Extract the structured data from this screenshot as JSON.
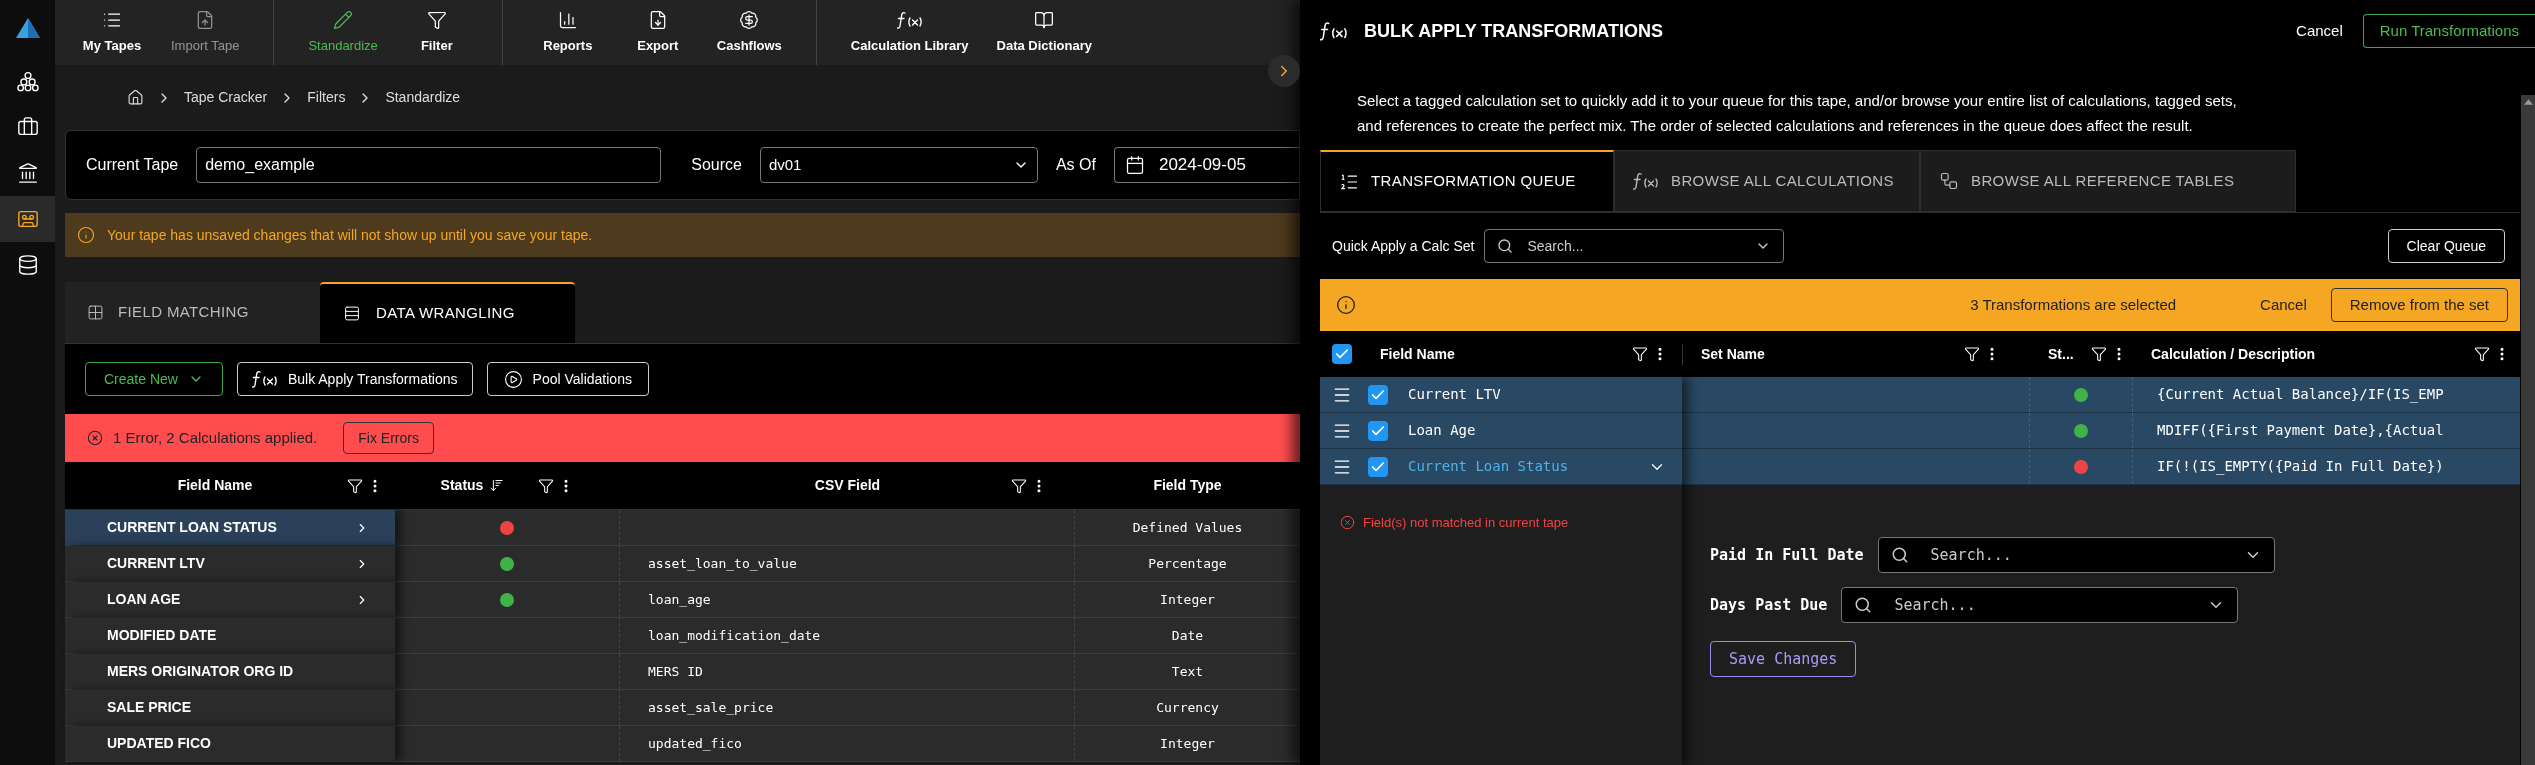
{
  "rail": {
    "items": [
      {
        "kind": "network",
        "selected": false
      },
      {
        "kind": "briefcase",
        "selected": false
      },
      {
        "kind": "bank",
        "selected": false
      },
      {
        "kind": "tape",
        "selected": true
      },
      {
        "kind": "database",
        "selected": false
      }
    ]
  },
  "toolbar": {
    "groups": [
      {
        "items": [
          {
            "kind": "list",
            "label": "My Tapes",
            "selected": false,
            "disabled": false
          },
          {
            "kind": "import",
            "label": "Import Tape",
            "selected": false,
            "disabled": true
          }
        ]
      },
      {
        "items": [
          {
            "kind": "pencil",
            "label": "Standardize",
            "selected": true,
            "disabled": false
          },
          {
            "kind": "filter",
            "label": "Filter",
            "selected": false,
            "disabled": false
          }
        ]
      },
      {
        "items": [
          {
            "kind": "chart",
            "label": "Reports",
            "selected": false,
            "disabled": false
          },
          {
            "kind": "export",
            "label": "Export",
            "selected": false,
            "disabled": false
          },
          {
            "kind": "dollar",
            "label": "Cashflows",
            "selected": false,
            "disabled": false
          }
        ]
      },
      {
        "items": [
          {
            "kind": "function",
            "label": "Calculation Library",
            "selected": false,
            "disabled": false
          },
          {
            "kind": "book",
            "label": "Data Dictionary",
            "selected": false,
            "disabled": false
          }
        ]
      }
    ]
  },
  "breadcrumb": [
    "Tape Cracker",
    "Filters",
    "Standardize"
  ],
  "tape_form": {
    "current_tape_label": "Current Tape",
    "current_tape": "demo_example",
    "source_label": "Source",
    "source": "dv01",
    "as_of_label": "As Of",
    "as_of": "2024-09-05"
  },
  "warning": "Your tape has unsaved changes that will not show up until you save your tape.",
  "tabs": [
    {
      "kind": "grid",
      "label": "FIELD MATCHING",
      "selected": false
    },
    {
      "kind": "rows",
      "label": "DATA WRANGLING",
      "selected": true
    }
  ],
  "actions": {
    "create_new": "Create New",
    "bulk_apply": "Bulk Apply Transformations",
    "pool_validations": "Pool Validations"
  },
  "error_bar": {
    "text": "1 Error, 2 Calculations applied.",
    "button": "Fix Errors"
  },
  "table": {
    "columns": [
      "Field Name",
      "Status",
      "CSV Field",
      "Field Type"
    ],
    "rows": [
      {
        "field_name": "CURRENT LOAN STATUS",
        "expandable": true,
        "selected": true,
        "color": "#ef4444",
        "csv_field": "",
        "field_type": "Defined Values"
      },
      {
        "field_name": "CURRENT LTV",
        "expandable": true,
        "selected": false,
        "color": "#3fb24a",
        "csv_field": "asset_loan_to_value",
        "field_type": "Percentage"
      },
      {
        "field_name": "LOAN AGE",
        "expandable": true,
        "selected": false,
        "color": "#3fb24a",
        "csv_field": "loan_age",
        "field_type": "Integer"
      },
      {
        "field_name": "MODIFIED DATE",
        "expandable": false,
        "selected": false,
        "csv_field": "loan_modification_date",
        "field_type": "Date"
      },
      {
        "field_name": "MERS ORIGINATOR ORG ID",
        "expandable": false,
        "selected": false,
        "csv_field": "MERS ID",
        "field_type": "Text"
      },
      {
        "field_name": "SALE PRICE",
        "expandable": false,
        "selected": false,
        "csv_field": "asset_sale_price",
        "field_type": "Currency"
      },
      {
        "field_name": "UPDATED FICO",
        "expandable": false,
        "selected": false,
        "csv_field": "updated_fico",
        "field_type": "Integer"
      }
    ]
  },
  "panel": {
    "title": "BULK APPLY TRANSFORMATIONS",
    "cancel": "Cancel",
    "run": "Run Transformations",
    "description": "Select a tagged calculation set to quickly add it to your queue for this tape, and/or browse your entire list of calculations, tagged sets, and references to create the perfect mix. The order of selected calculations and references in the queue does affect the result.",
    "tabs": [
      {
        "kind": "queue",
        "label": "TRANSFORMATION QUEUE",
        "selected": true
      },
      {
        "kind": "function",
        "label": "BROWSE ALL CALCULATIONS",
        "selected": false
      },
      {
        "kind": "tree",
        "label": "BROWSE ALL REFERENCE TABLES",
        "selected": false
      }
    ],
    "quick_apply": {
      "label": "Quick Apply a Calc Set",
      "placeholder": "Search..."
    },
    "clear_queue": "Clear Queue",
    "selection_bar": {
      "text": "3 Transformations are selected",
      "cancel": "Cancel",
      "remove": "Remove from the set"
    },
    "table": {
      "all_checked": true,
      "columns": [
        "Field Name",
        "Set Name",
        "St...",
        "Calculation / Description"
      ],
      "rows": [
        {
          "field_name": "Current LTV",
          "checked": true,
          "expanded": false,
          "color": "#3fb24a",
          "calculation": "{Current Actual Balance}/IF(IS_EMP"
        },
        {
          "field_name": "Loan Age",
          "checked": true,
          "expanded": false,
          "color": "#3fb24a",
          "calculation": "MDIFF({First Payment Date},{Actual"
        },
        {
          "field_name": "Current Loan Status",
          "checked": true,
          "expanded": true,
          "color": "#ef4444",
          "calculation": "IF(!(IS_EMPTY({Paid In Full Date})"
        }
      ]
    },
    "error": "Field(s) not matched in current tape",
    "mappings": [
      {
        "label": "Paid In Full Date",
        "placeholder": "Search..."
      },
      {
        "label": "Days Past Due",
        "placeholder": "Search..."
      }
    ],
    "save": "Save Changes"
  }
}
